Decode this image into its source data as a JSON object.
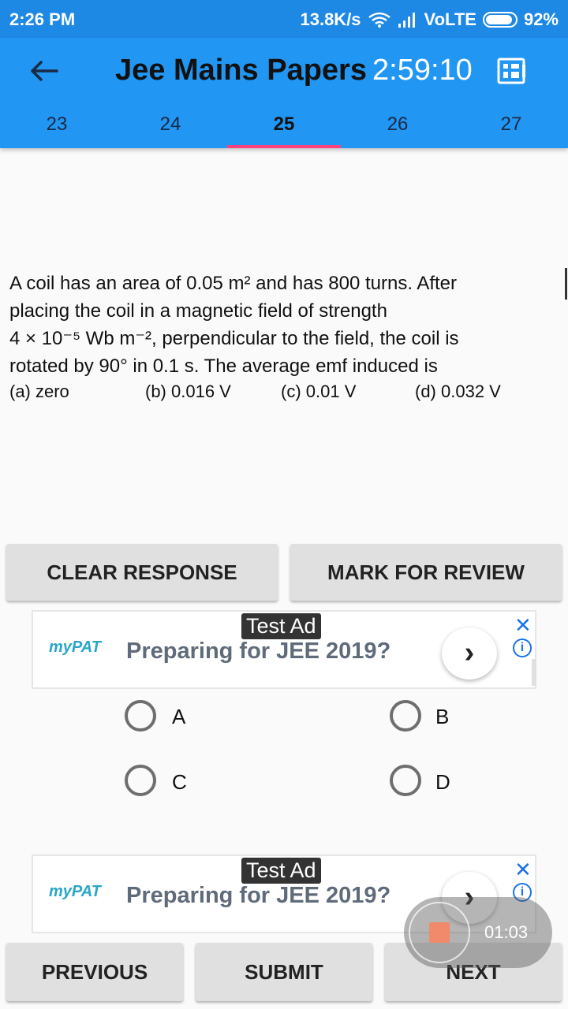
{
  "status_bar": {
    "time": "2:26 PM",
    "speed": "13.8K/s",
    "network": "VoLTE",
    "battery": "92%",
    "battery_level": 0.92
  },
  "app_bar": {
    "title": "Jee Mains Papers",
    "timer": "2:59:10",
    "back_icon": "arrow-back-icon",
    "menu_icon": "grid-view-icon"
  },
  "tabs": [
    {
      "label": "23"
    },
    {
      "label": "24"
    },
    {
      "label": "25",
      "active": true
    },
    {
      "label": "26"
    },
    {
      "label": "27"
    }
  ],
  "question": {
    "line1": "A coil has an area of 0.05 m² and has 800 turns. After",
    "line2": "placing the coil in a magnetic field of strength",
    "line3": "4 × 10⁻⁵ Wb m⁻², perpendicular to the field, the coil is",
    "line4": "rotated by 90° in 0.1 s. The average emf induced is",
    "options": [
      "(a) zero",
      "(b) 0.016 V",
      "(c) 0.01 V",
      "(d) 0.032 V"
    ]
  },
  "actions": {
    "clear": "CLEAR RESPONSE",
    "review": "MARK FOR REVIEW"
  },
  "ad": {
    "tag": "Test Ad",
    "logo": "myPAT",
    "text": "Preparing for JEE 2019?",
    "arrow": "›",
    "close": "✕",
    "info": "i"
  },
  "answers": [
    "A",
    "B",
    "C",
    "D"
  ],
  "recorder": {
    "time": "01:03"
  },
  "footer": {
    "previous": "PREVIOUS",
    "submit": "SUBMIT",
    "next": "NEXT"
  },
  "colors": {
    "status_bar": "#1e88e5",
    "app_bar": "#2196f3",
    "tab_indicator": "#ff4081"
  }
}
